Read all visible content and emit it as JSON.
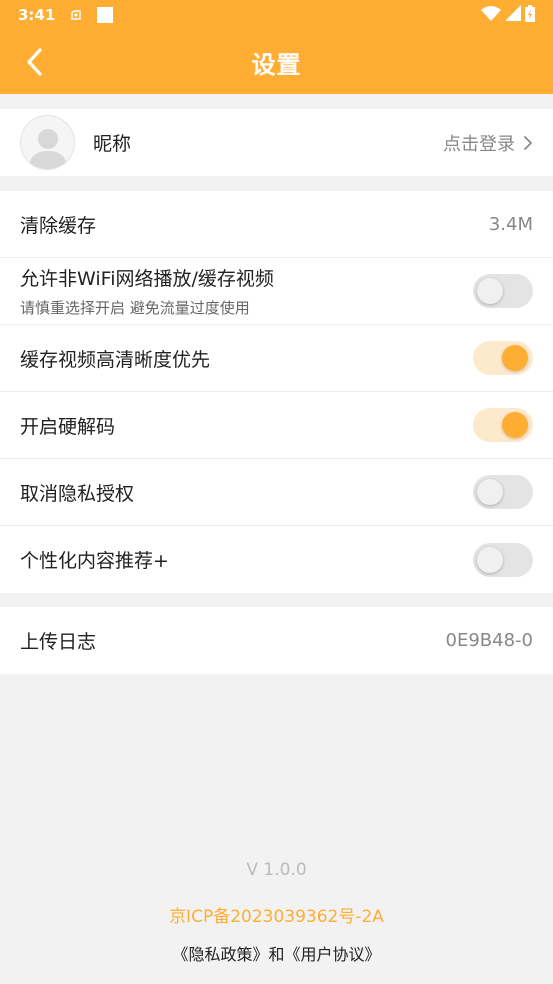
{
  "status_bar": {
    "time": "3:41",
    "icons": [
      "notification-icon",
      "square-icon",
      "wifi-icon",
      "signal-icon",
      "battery-icon"
    ]
  },
  "header": {
    "title": "设置",
    "back_icon": "back-chevron-icon"
  },
  "profile": {
    "nickname_label": "昵称",
    "login_text": "点击登录"
  },
  "settings": {
    "clear_cache": {
      "label": "清除缓存",
      "value": "3.4M"
    },
    "non_wifi": {
      "label": "允许非WiFi网络播放/缓存视频",
      "sub": "请慎重选择开启 避免流量过度使用",
      "enabled": false
    },
    "hd_cache": {
      "label": "缓存视频高清晰度优先",
      "enabled": true
    },
    "hw_decode": {
      "label": "开启硬解码",
      "enabled": true
    },
    "privacy": {
      "label": "取消隐私授权",
      "enabled": false
    },
    "personalized": {
      "label": "个性化内容推荐+",
      "enabled": false
    }
  },
  "log": {
    "label": "上传日志",
    "value": "0E9B48-0"
  },
  "footer": {
    "version": "V 1.0.0",
    "icp": "京ICP备2023039362号-2A",
    "privacy_link": "《隐私政策》",
    "and": "和",
    "agreement_link": "《用户协议》"
  },
  "colors": {
    "accent": "#ffad33",
    "toggle_on_track": "#fde9cc",
    "toggle_off_track": "#e4e4e4",
    "background": "#f2f2f2"
  }
}
